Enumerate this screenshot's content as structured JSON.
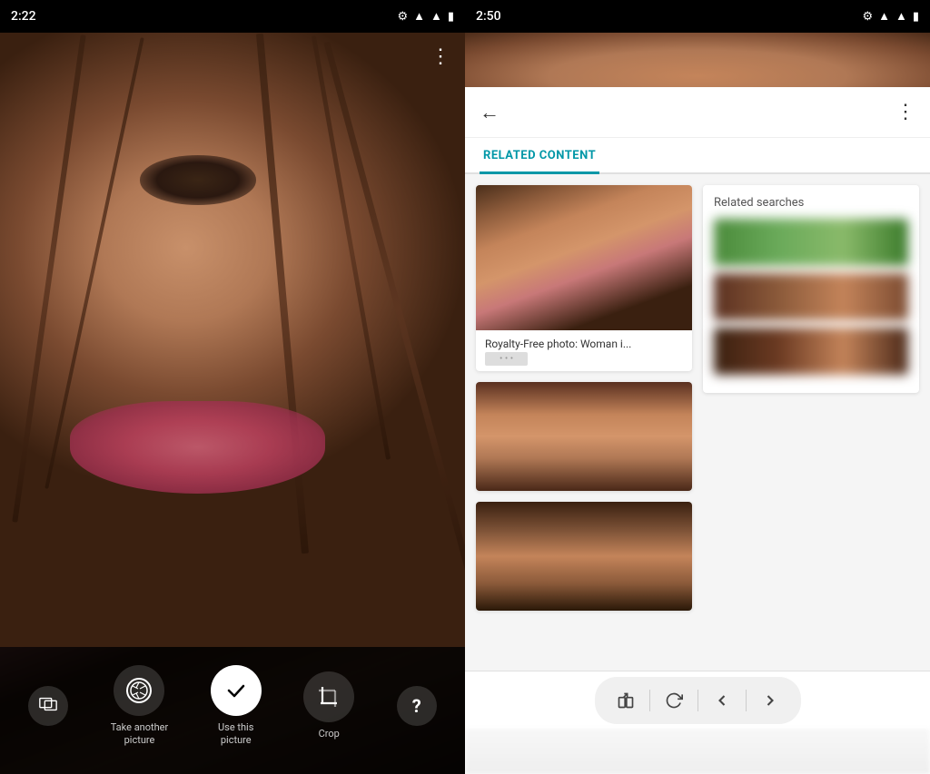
{
  "left": {
    "status": {
      "time": "2:22",
      "gear_icon": "⚙",
      "wifi_icon": "▲",
      "signal_icon": "▲",
      "battery_icon": "▮"
    },
    "three_dots": "⋮",
    "toolbar": {
      "gallery_label": "",
      "take_another_label": "Take another\npicture",
      "use_this_label": "Use this\npicture",
      "crop_label": "Crop",
      "help_label": "?"
    }
  },
  "right": {
    "status": {
      "time": "2:50",
      "gear_icon": "⚙",
      "wifi_icon": "▲",
      "signal_icon": "▲",
      "battery_icon": "▮"
    },
    "header": {
      "back_label": "←",
      "three_dots": "⋮"
    },
    "tab": {
      "label": "RELATED CONTENT"
    },
    "result_card": {
      "title": "Royalty-Free photo: Woman i...",
      "url": "• • •"
    },
    "related_searches": {
      "title": "Related searches"
    },
    "nav": {
      "share_icon": "⬒",
      "refresh_icon": "↻",
      "back_icon": "‹",
      "forward_icon": "›"
    }
  }
}
